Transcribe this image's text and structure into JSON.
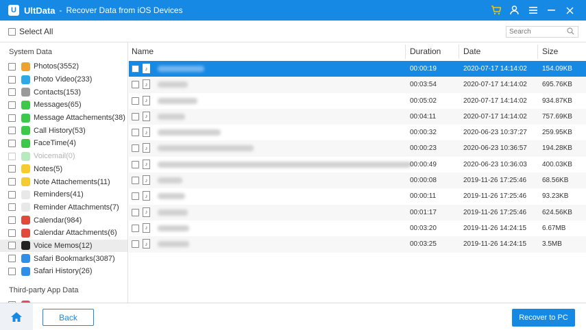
{
  "titlebar": {
    "logo_letter": "U",
    "app_name": "UltData",
    "separator": "-",
    "subtitle": "Recover Data from iOS Devices",
    "icons": [
      "cart-icon",
      "user-icon",
      "menu-icon",
      "minimize-icon",
      "close-icon"
    ]
  },
  "toolbar": {
    "select_all": "Select All",
    "search_placeholder": "Search"
  },
  "sidebar": {
    "system_title": "System Data",
    "third_party_title": "Third-party App Data",
    "items": [
      {
        "label": "Photos(3552)",
        "icon": "photos-icon",
        "color": "#f0a030"
      },
      {
        "label": "Photo Video(233)",
        "icon": "photo-video-icon",
        "color": "#2fa8e8"
      },
      {
        "label": "Contacts(153)",
        "icon": "contacts-icon",
        "color": "#9a9a9a"
      },
      {
        "label": "Messages(65)",
        "icon": "messages-icon",
        "color": "#3cc94a"
      },
      {
        "label": "Message Attachements(38)",
        "icon": "message-attachments-icon",
        "color": "#3cc94a"
      },
      {
        "label": "Call History(53)",
        "icon": "call-history-icon",
        "color": "#3cc94a"
      },
      {
        "label": "FaceTime(4)",
        "icon": "facetime-icon",
        "color": "#3cc94a"
      },
      {
        "label": "Voicemail(0)",
        "icon": "voicemail-icon",
        "color": "#7fd88a"
      },
      {
        "label": "Notes(5)",
        "icon": "notes-icon",
        "color": "#f5cc30"
      },
      {
        "label": "Note Attachements(11)",
        "icon": "note-attachments-icon",
        "color": "#f5cc30"
      },
      {
        "label": "Reminders(41)",
        "icon": "reminders-icon",
        "color": "#e8e8e8"
      },
      {
        "label": "Reminder Attachments(7)",
        "icon": "reminder-attachments-icon",
        "color": "#e8e8e8"
      },
      {
        "label": "Calendar(984)",
        "icon": "calendar-icon",
        "color": "#e04a3a"
      },
      {
        "label": "Calendar Attachments(6)",
        "icon": "calendar-attachments-icon",
        "color": "#e04a3a"
      },
      {
        "label": "Voice Memos(12)",
        "icon": "voice-memos-icon",
        "color": "#222222"
      },
      {
        "label": "Safari Bookmarks(3087)",
        "icon": "safari-bookmarks-icon",
        "color": "#2f8fe8"
      },
      {
        "label": "Safari History(26)",
        "icon": "safari-history-icon",
        "color": "#2f8fe8"
      }
    ],
    "active_index": 14,
    "disabled_index": 7
  },
  "table": {
    "headers": {
      "name": "Name",
      "duration": "Duration",
      "date": "Date",
      "size": "Size"
    },
    "rows": [
      {
        "duration": "00:00:19",
        "date": "2020-07-17 14:14:02",
        "size": "154.09KB"
      },
      {
        "duration": "00:03:54",
        "date": "2020-07-17 14:14:02",
        "size": "695.76KB"
      },
      {
        "duration": "00:05:02",
        "date": "2020-07-17 14:14:02",
        "size": "934.87KB"
      },
      {
        "duration": "00:04:11",
        "date": "2020-07-17 14:14:02",
        "size": "757.69KB"
      },
      {
        "duration": "00:00:32",
        "date": "2020-06-23 10:37:27",
        "size": "259.95KB"
      },
      {
        "duration": "00:00:23",
        "date": "2020-06-23 10:36:57",
        "size": "194.28KB"
      },
      {
        "duration": "00:00:49",
        "date": "2020-06-23 10:36:03",
        "size": "400.03KB"
      },
      {
        "duration": "00:00:08",
        "date": "2019-11-26 17:25:46",
        "size": "68.56KB"
      },
      {
        "duration": "00:00:11",
        "date": "2019-11-26 17:25:46",
        "size": "93.23KB"
      },
      {
        "duration": "00:01:17",
        "date": "2019-11-26 17:25:46",
        "size": "624.56KB"
      },
      {
        "duration": "00:03:20",
        "date": "2019-11-26 14:24:15",
        "size": "6.67MB"
      },
      {
        "duration": "00:03:25",
        "date": "2019-11-26 14:24:15",
        "size": "3.5MB"
      }
    ],
    "selected_index": 0
  },
  "footer": {
    "back": "Back",
    "recover": "Recover to PC"
  },
  "colors": {
    "accent": "#1589e3",
    "cart": "#f5c400"
  }
}
